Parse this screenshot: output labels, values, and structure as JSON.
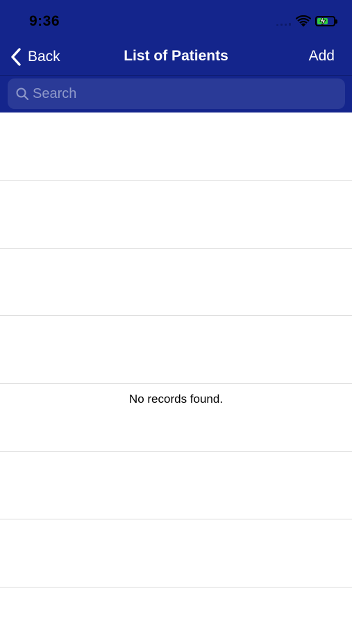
{
  "status_bar": {
    "time": "9:36"
  },
  "nav": {
    "back_label": "Back",
    "title": "List of Patients",
    "add_label": "Add"
  },
  "search": {
    "placeholder": "Search",
    "value": ""
  },
  "list": {
    "empty_message": "No records found."
  },
  "colors": {
    "nav_background": "#14258c",
    "search_background": "#2a3a97",
    "battery_fill": "#2ecc40"
  }
}
